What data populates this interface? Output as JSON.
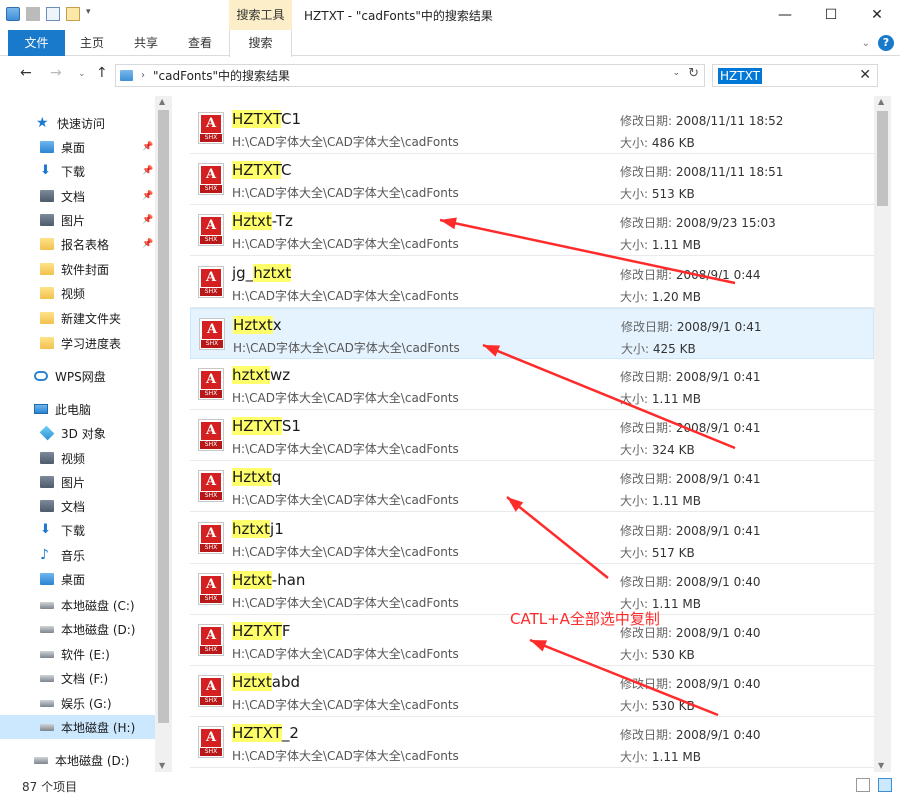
{
  "window": {
    "context_tab": "搜索工具",
    "title": "HZTXT - \"cadFonts\"中的搜索结果",
    "minimize": "—",
    "maximize": "☐",
    "close": "✕"
  },
  "ribbon": {
    "tabs": [
      "文件",
      "主页",
      "共享",
      "查看",
      "搜索"
    ],
    "collapse_icon": "chevron-down-icon",
    "help": "?"
  },
  "address": {
    "back": "←",
    "forward": "→",
    "up": "↑",
    "path": "\"cadFonts\"中的搜索结果",
    "refresh": "↻"
  },
  "search": {
    "value": "HZTXT",
    "clear": "✕"
  },
  "sidebar": {
    "items": [
      {
        "label": "快速访问",
        "icon": "star-icon",
        "pin": false
      },
      {
        "label": "桌面",
        "icon": "desktop-icon",
        "pin": true
      },
      {
        "label": "下载",
        "icon": "download-icon",
        "pin": true
      },
      {
        "label": "文档",
        "icon": "documents-icon",
        "pin": true
      },
      {
        "label": "图片",
        "icon": "pictures-icon",
        "pin": true
      },
      {
        "label": "报名表格",
        "icon": "folder-icon",
        "pin": true
      },
      {
        "label": "软件封面",
        "icon": "folder-icon",
        "pin": false
      },
      {
        "label": "视频",
        "icon": "folder-icon",
        "pin": false
      },
      {
        "label": "新建文件夹",
        "icon": "folder-icon",
        "pin": false
      },
      {
        "label": "学习进度表",
        "icon": "folder-icon",
        "pin": false
      },
      {
        "label": "WPS网盘",
        "icon": "cloud-icon",
        "pin": false
      },
      {
        "label": "此电脑",
        "icon": "computer-icon",
        "pin": false
      },
      {
        "label": "3D 对象",
        "icon": "3d-objects-icon",
        "pin": false
      },
      {
        "label": "视频",
        "icon": "videos-icon",
        "pin": false
      },
      {
        "label": "图片",
        "icon": "pictures-icon",
        "pin": false
      },
      {
        "label": "文档",
        "icon": "documents-icon",
        "pin": false
      },
      {
        "label": "下载",
        "icon": "download-icon",
        "pin": false
      },
      {
        "label": "音乐",
        "icon": "music-icon",
        "pin": false
      },
      {
        "label": "桌面",
        "icon": "desktop-icon",
        "pin": false
      },
      {
        "label": "本地磁盘 (C:)",
        "icon": "drive-icon",
        "pin": false
      },
      {
        "label": "本地磁盘 (D:)",
        "icon": "drive-icon",
        "pin": false
      },
      {
        "label": "软件 (E:)",
        "icon": "drive-icon",
        "pin": false
      },
      {
        "label": "文档 (F:)",
        "icon": "drive-icon",
        "pin": false
      },
      {
        "label": "娱乐 (G:)",
        "icon": "drive-icon",
        "pin": false
      },
      {
        "label": "本地磁盘 (H:)",
        "icon": "drive-icon",
        "pin": false,
        "selected": true
      },
      {
        "label": "本地磁盘 (D:)",
        "icon": "drive-icon",
        "pin": false
      }
    ]
  },
  "labels": {
    "modified": "修改日期:",
    "size": "大小:",
    "file_icon_text": "A",
    "file_icon_ext": "SHX"
  },
  "files": [
    {
      "match": "HZTXT",
      "rest": "C1",
      "path": "H:\\CAD字体大全\\CAD字体大全\\cadFonts",
      "modified": "2008/11/11 18:52",
      "size": "486 KB"
    },
    {
      "match": "HZTXT",
      "rest": "C",
      "path": "H:\\CAD字体大全\\CAD字体大全\\cadFonts",
      "modified": "2008/11/11 18:51",
      "size": "513 KB"
    },
    {
      "match": "Hztxt",
      "rest": "-Tz",
      "path": "H:\\CAD字体大全\\CAD字体大全\\cadFonts",
      "modified": "2008/9/23 15:03",
      "size": "1.11 MB"
    },
    {
      "prefix": "jg_",
      "match": "hztxt",
      "rest": "",
      "path": "H:\\CAD字体大全\\CAD字体大全\\cadFonts",
      "modified": "2008/9/1 0:44",
      "size": "1.20 MB"
    },
    {
      "match": "Hztxt",
      "rest": "x",
      "path": "H:\\CAD字体大全\\CAD字体大全\\cadFonts",
      "modified": "2008/9/1 0:41",
      "size": "425 KB",
      "highlighted": true
    },
    {
      "match": "hztxt",
      "rest": "wz",
      "path": "H:\\CAD字体大全\\CAD字体大全\\cadFonts",
      "modified": "2008/9/1 0:41",
      "size": "1.11 MB"
    },
    {
      "match": "HZTXT",
      "rest": "S1",
      "path": "H:\\CAD字体大全\\CAD字体大全\\cadFonts",
      "modified": "2008/9/1 0:41",
      "size": "324 KB"
    },
    {
      "match": "Hztxt",
      "rest": "q",
      "path": "H:\\CAD字体大全\\CAD字体大全\\cadFonts",
      "modified": "2008/9/1 0:41",
      "size": "1.11 MB"
    },
    {
      "match": "hztxt",
      "rest": "j1",
      "path": "H:\\CAD字体大全\\CAD字体大全\\cadFonts",
      "modified": "2008/9/1 0:41",
      "size": "517 KB"
    },
    {
      "match": "Hztxt",
      "rest": "-han",
      "path": "H:\\CAD字体大全\\CAD字体大全\\cadFonts",
      "modified": "2008/9/1 0:40",
      "size": "1.11 MB"
    },
    {
      "match": "HZTXT",
      "rest": "F",
      "path": "H:\\CAD字体大全\\CAD字体大全\\cadFonts",
      "modified": "2008/9/1 0:40",
      "size": "530 KB"
    },
    {
      "match": "Hztxt",
      "rest": "abd",
      "path": "H:\\CAD字体大全\\CAD字体大全\\cadFonts",
      "modified": "2008/9/1 0:40",
      "size": "530 KB"
    },
    {
      "match": "HZTXT",
      "rest": "_2",
      "path": "H:\\CAD字体大全\\CAD字体大全\\cadFonts",
      "modified": "2008/9/1 0:40",
      "size": "1.11 MB"
    }
  ],
  "annotation": {
    "text": "CATL+A全部选中复制",
    "color": "#ff2b2b"
  },
  "status": {
    "count": "87 个项目"
  },
  "colors": {
    "accent": "#1979ca",
    "match_highlight": "#ffff6b",
    "row_highlight": "#e5f3ff",
    "context_tab": "#fbeec8"
  }
}
